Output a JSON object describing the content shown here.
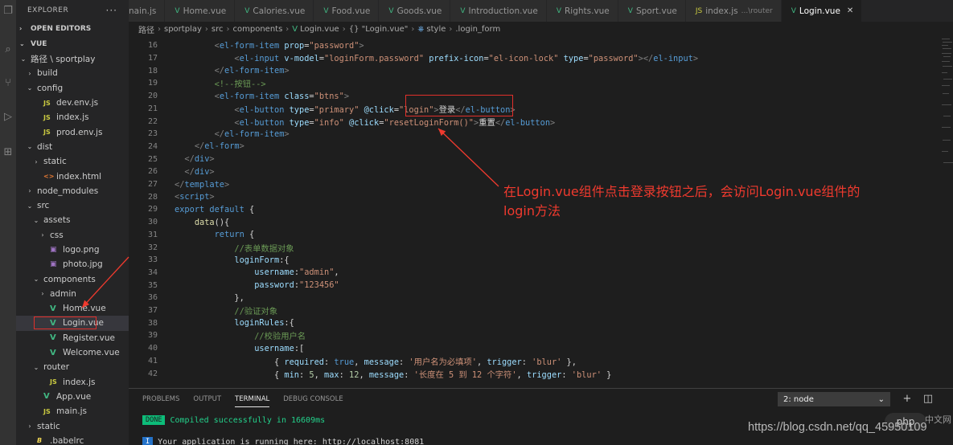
{
  "sidebar": {
    "title": "EXPLORER",
    "more": "···",
    "open_editors": "OPEN EDITORS",
    "section": "VUE",
    "tree": [
      {
        "label": "路径 \\ sportplay",
        "chev": "⌄",
        "indent": 0,
        "icon": ""
      },
      {
        "label": "build",
        "chev": "›",
        "indent": 1,
        "icon": ""
      },
      {
        "label": "config",
        "chev": "⌄",
        "indent": 1,
        "icon": ""
      },
      {
        "label": "dev.env.js",
        "chev": "",
        "indent": 2,
        "icon": "JS"
      },
      {
        "label": "index.js",
        "chev": "",
        "indent": 2,
        "icon": "JS"
      },
      {
        "label": "prod.env.js",
        "chev": "",
        "indent": 2,
        "icon": "JS"
      },
      {
        "label": "dist",
        "chev": "⌄",
        "indent": 1,
        "icon": ""
      },
      {
        "label": "static",
        "chev": "›",
        "indent": 2,
        "icon": ""
      },
      {
        "label": "index.html",
        "chev": "",
        "indent": 2,
        "icon": "<>"
      },
      {
        "label": "node_modules",
        "chev": "›",
        "indent": 1,
        "icon": ""
      },
      {
        "label": "src",
        "chev": "⌄",
        "indent": 1,
        "icon": ""
      },
      {
        "label": "assets",
        "chev": "⌄",
        "indent": 2,
        "icon": ""
      },
      {
        "label": "css",
        "chev": "›",
        "indent": 3,
        "icon": ""
      },
      {
        "label": "logo.png",
        "chev": "",
        "indent": 3,
        "icon": "▣"
      },
      {
        "label": "photo.jpg",
        "chev": "",
        "indent": 3,
        "icon": "▣"
      },
      {
        "label": "components",
        "chev": "⌄",
        "indent": 2,
        "icon": ""
      },
      {
        "label": "admin",
        "chev": "›",
        "indent": 3,
        "icon": ""
      },
      {
        "label": "Home.vue",
        "chev": "",
        "indent": 3,
        "icon": "V"
      },
      {
        "label": "Login.vue",
        "chev": "",
        "indent": 3,
        "icon": "V"
      },
      {
        "label": "Register.vue",
        "chev": "",
        "indent": 3,
        "icon": "V"
      },
      {
        "label": "Welcome.vue",
        "chev": "",
        "indent": 3,
        "icon": "V"
      },
      {
        "label": "router",
        "chev": "⌄",
        "indent": 2,
        "icon": ""
      },
      {
        "label": "index.js",
        "chev": "",
        "indent": 3,
        "icon": "JS"
      },
      {
        "label": "App.vue",
        "chev": "",
        "indent": 2,
        "icon": "V"
      },
      {
        "label": "main.js",
        "chev": "",
        "indent": 2,
        "icon": "JS"
      },
      {
        "label": "static",
        "chev": "›",
        "indent": 1,
        "icon": ""
      },
      {
        "label": ".babelrc",
        "chev": "",
        "indent": 1,
        "icon": "B"
      }
    ]
  },
  "tabs": [
    {
      "label": "nain.js",
      "icon": "",
      "hint": ""
    },
    {
      "label": "Home.vue",
      "icon": "V",
      "hint": ""
    },
    {
      "label": "Calories.vue",
      "icon": "V",
      "hint": ""
    },
    {
      "label": "Food.vue",
      "icon": "V",
      "hint": ""
    },
    {
      "label": "Goods.vue",
      "icon": "V",
      "hint": ""
    },
    {
      "label": "Introduction.vue",
      "icon": "V",
      "hint": ""
    },
    {
      "label": "Rights.vue",
      "icon": "V",
      "hint": ""
    },
    {
      "label": "Sport.vue",
      "icon": "V",
      "hint": ""
    },
    {
      "label": "index.js",
      "icon": "JS",
      "hint": "...\\router"
    },
    {
      "label": "Login.vue",
      "icon": "V",
      "hint": "",
      "active": true
    }
  ],
  "breadcrumb": {
    "parts": [
      "路径",
      "sportplay",
      "src",
      "components",
      "Login.vue",
      "{} \"Login.vue\"",
      "style",
      ".login_form"
    ],
    "icons": {
      "vue": "V",
      "braces": "",
      "style": "⎈"
    }
  },
  "code": {
    "lines": [
      {
        "n": "16",
        "parts": [
          [
            "p",
            "        "
          ],
          [
            "t",
            "<"
          ],
          [
            "g",
            "el-form-item"
          ],
          [
            "a",
            " prop"
          ],
          [
            "p",
            "="
          ],
          [
            "s",
            "\"password\""
          ],
          [
            "t",
            ">"
          ]
        ]
      },
      {
        "n": "17",
        "parts": [
          [
            "p",
            "            "
          ],
          [
            "t",
            "<"
          ],
          [
            "g",
            "el-input"
          ],
          [
            "a",
            " v-model"
          ],
          [
            "p",
            "="
          ],
          [
            "s",
            "\"loginForm.password\""
          ],
          [
            "a",
            " prefix-icon"
          ],
          [
            "p",
            "="
          ],
          [
            "s",
            "\"el-icon-lock\""
          ],
          [
            "a",
            " type"
          ],
          [
            "p",
            "="
          ],
          [
            "s",
            "\"password\""
          ],
          [
            "t",
            "></"
          ],
          [
            "g",
            "el-input"
          ],
          [
            "t",
            ">"
          ]
        ]
      },
      {
        "n": "18",
        "parts": [
          [
            "p",
            "        "
          ],
          [
            "t",
            "</"
          ],
          [
            "g",
            "el-form-item"
          ],
          [
            "t",
            ">"
          ]
        ]
      },
      {
        "n": "19",
        "parts": [
          [
            "p",
            "        "
          ],
          [
            "c",
            "<!--按钮-->"
          ]
        ]
      },
      {
        "n": "20",
        "parts": [
          [
            "p",
            "        "
          ],
          [
            "t",
            "<"
          ],
          [
            "g",
            "el-form-item"
          ],
          [
            "a",
            " class"
          ],
          [
            "p",
            "="
          ],
          [
            "s",
            "\"btns\""
          ],
          [
            "t",
            ">"
          ]
        ]
      },
      {
        "n": "21",
        "parts": [
          [
            "p",
            "            "
          ],
          [
            "t",
            "<"
          ],
          [
            "g",
            "el-button"
          ],
          [
            "a",
            " type"
          ],
          [
            "p",
            "="
          ],
          [
            "s",
            "\"primary\""
          ],
          [
            "a",
            " @click"
          ],
          [
            "p",
            "="
          ],
          [
            "s",
            "\"login\""
          ],
          [
            "t",
            ">"
          ],
          [
            "x",
            "登录"
          ],
          [
            "t",
            "</"
          ],
          [
            "g",
            "el-button"
          ],
          [
            "t",
            ">"
          ]
        ]
      },
      {
        "n": "22",
        "parts": [
          [
            "p",
            "            "
          ],
          [
            "t",
            "<"
          ],
          [
            "g",
            "el-button"
          ],
          [
            "a",
            " type"
          ],
          [
            "p",
            "="
          ],
          [
            "s",
            "\"info\""
          ],
          [
            "a",
            " @click"
          ],
          [
            "p",
            "="
          ],
          [
            "s",
            "\"resetLoginForm()\""
          ],
          [
            "t",
            ">"
          ],
          [
            "x",
            "重置"
          ],
          [
            "t",
            "</"
          ],
          [
            "g",
            "el-button"
          ],
          [
            "t",
            ">"
          ]
        ]
      },
      {
        "n": "23",
        "parts": [
          [
            "p",
            "        "
          ],
          [
            "t",
            "</"
          ],
          [
            "g",
            "el-form-item"
          ],
          [
            "t",
            ">"
          ]
        ]
      },
      {
        "n": "24",
        "parts": [
          [
            "p",
            "    "
          ],
          [
            "t",
            "</"
          ],
          [
            "g",
            "el-form"
          ],
          [
            "t",
            ">"
          ]
        ]
      },
      {
        "n": "25",
        "parts": [
          [
            "p",
            "  "
          ],
          [
            "t",
            "</"
          ],
          [
            "g",
            "div"
          ],
          [
            "t",
            ">"
          ]
        ]
      },
      {
        "n": "26",
        "parts": [
          [
            "p",
            "  "
          ],
          [
            "t",
            "</"
          ],
          [
            "g",
            "div"
          ],
          [
            "t",
            ">"
          ]
        ]
      },
      {
        "n": "27",
        "parts": [
          [
            "t",
            "</"
          ],
          [
            "g",
            "template"
          ],
          [
            "t",
            ">"
          ]
        ]
      },
      {
        "n": "28",
        "parts": [
          [
            "t",
            "<"
          ],
          [
            "g",
            "script"
          ],
          [
            "t",
            ">"
          ]
        ]
      },
      {
        "n": "29",
        "parts": [
          [
            "k",
            "export"
          ],
          [
            "x",
            " "
          ],
          [
            "k",
            "default"
          ],
          [
            "x",
            " {"
          ]
        ]
      },
      {
        "n": "30",
        "parts": [
          [
            "p",
            "    "
          ],
          [
            "f",
            "data"
          ],
          [
            "x",
            "(){"
          ]
        ]
      },
      {
        "n": "31",
        "parts": [
          [
            "p",
            "        "
          ],
          [
            "k",
            "return"
          ],
          [
            "x",
            " {"
          ]
        ]
      },
      {
        "n": "32",
        "parts": [
          [
            "p",
            "            "
          ],
          [
            "c",
            "//表单数据对象"
          ]
        ]
      },
      {
        "n": "33",
        "parts": [
          [
            "p",
            "            "
          ],
          [
            "a",
            "loginForm"
          ],
          [
            "x",
            ":{"
          ]
        ]
      },
      {
        "n": "34",
        "parts": [
          [
            "p",
            "                "
          ],
          [
            "a",
            "username"
          ],
          [
            "x",
            ":"
          ],
          [
            "s",
            "\"admin\""
          ],
          [
            "x",
            ","
          ]
        ]
      },
      {
        "n": "35",
        "parts": [
          [
            "p",
            "                "
          ],
          [
            "a",
            "password"
          ],
          [
            "x",
            ":"
          ],
          [
            "s",
            "\"123456\""
          ]
        ]
      },
      {
        "n": "36",
        "parts": [
          [
            "p",
            "            "
          ],
          [
            "x",
            "},"
          ]
        ]
      },
      {
        "n": "37",
        "parts": [
          [
            "p",
            "            "
          ],
          [
            "c",
            "//验证对象"
          ]
        ]
      },
      {
        "n": "38",
        "parts": [
          [
            "p",
            "            "
          ],
          [
            "a",
            "loginRules"
          ],
          [
            "x",
            ":{"
          ]
        ]
      },
      {
        "n": "39",
        "parts": [
          [
            "p",
            "                "
          ],
          [
            "c",
            "//校验用户名"
          ]
        ]
      },
      {
        "n": "40",
        "parts": [
          [
            "p",
            "                "
          ],
          [
            "a",
            "username"
          ],
          [
            "x",
            ":["
          ]
        ]
      },
      {
        "n": "41",
        "parts": [
          [
            "p",
            "                    "
          ],
          [
            "x",
            "{ "
          ],
          [
            "a",
            "required"
          ],
          [
            "x",
            ": "
          ],
          [
            "b",
            "true"
          ],
          [
            "x",
            ", "
          ],
          [
            "a",
            "message"
          ],
          [
            "x",
            ": "
          ],
          [
            "s",
            "'用户名为必填项'"
          ],
          [
            "x",
            ", "
          ],
          [
            "a",
            "trigger"
          ],
          [
            "x",
            ": "
          ],
          [
            "s",
            "'blur'"
          ],
          [
            "x",
            " },"
          ]
        ]
      },
      {
        "n": "42",
        "parts": [
          [
            "p",
            "                    "
          ],
          [
            "x",
            "{ "
          ],
          [
            "a",
            "min"
          ],
          [
            "x",
            ": "
          ],
          [
            "u",
            "5"
          ],
          [
            "x",
            ", "
          ],
          [
            "a",
            "max"
          ],
          [
            "x",
            ": "
          ],
          [
            "u",
            "12"
          ],
          [
            "x",
            ", "
          ],
          [
            "a",
            "message"
          ],
          [
            "x",
            ": "
          ],
          [
            "s",
            "'长度在 5 到 12 个字符'"
          ],
          [
            "x",
            ", "
          ],
          [
            "a",
            "trigger"
          ],
          [
            "x",
            ": "
          ],
          [
            "s",
            "'blur'"
          ],
          [
            "x",
            " }"
          ]
        ]
      }
    ]
  },
  "annotation": {
    "text_line1": "在Login.vue组件点击登录按钮之后，会访问Login.vue组件的",
    "text_line2": "login方法",
    "color": "#f03a2e"
  },
  "panel": {
    "tabs": [
      "PROBLEMS",
      "OUTPUT",
      "TERMINAL",
      "DEBUG CONSOLE"
    ],
    "active_tab": "TERMINAL",
    "terminal_select": "2: node",
    "select_chevron": "⌄",
    "actions": [
      "+",
      "◫",
      "🗑",
      "⌃",
      "✕"
    ],
    "lines": [
      {
        "badge": "DONE",
        "text": "Compiled successfully in 16609ms"
      },
      {
        "badge": "I",
        "text": "Your application is running here: http://localhost:8081"
      }
    ]
  },
  "watermark": {
    "url": "https://blog.csdn.net/qq_45950109",
    "logo": "php",
    "cn": "中文网"
  }
}
